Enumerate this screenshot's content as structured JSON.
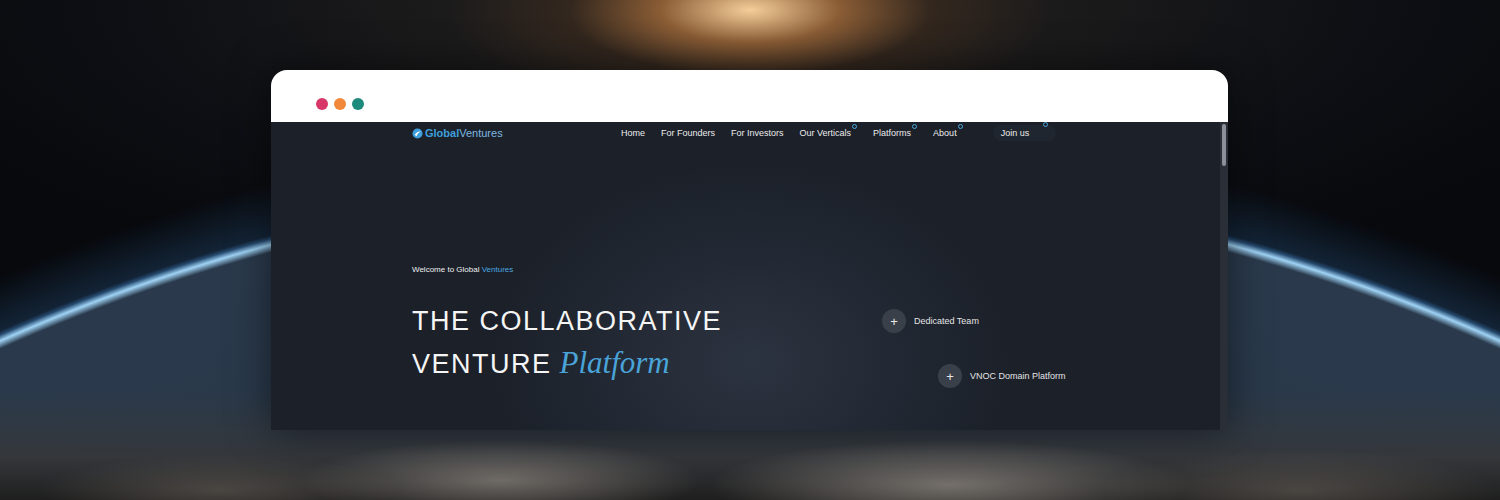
{
  "browser": {
    "dots": [
      {
        "color": "#d8376a"
      },
      {
        "color": "#f2893a"
      },
      {
        "color": "#1d8a7c"
      }
    ]
  },
  "logo": {
    "primary": "Global",
    "secondary": "Ventures"
  },
  "nav": [
    {
      "label": "Home",
      "has_dropdown": false,
      "button": false
    },
    {
      "label": "For Founders",
      "has_dropdown": false,
      "button": false
    },
    {
      "label": "For Investors",
      "has_dropdown": false,
      "button": false
    },
    {
      "label": "Our Verticals",
      "has_dropdown": true,
      "button": false
    },
    {
      "label": "Platforms",
      "has_dropdown": true,
      "button": false
    },
    {
      "label": "About",
      "has_dropdown": true,
      "button": false
    },
    {
      "label": "Join us",
      "has_dropdown": true,
      "button": true
    }
  ],
  "hero": {
    "eyebrow": "Welcome to Global ",
    "eyebrow_accent": "Ventures",
    "title_lines": [
      "THE COLLABORATIVE",
      "VENTURE"
    ],
    "title_accent": "Platform"
  },
  "features": [
    {
      "icon": "+",
      "label": "Dedicated Team"
    },
    {
      "icon": "+",
      "label": "VNOC Domain Platform"
    }
  ]
}
